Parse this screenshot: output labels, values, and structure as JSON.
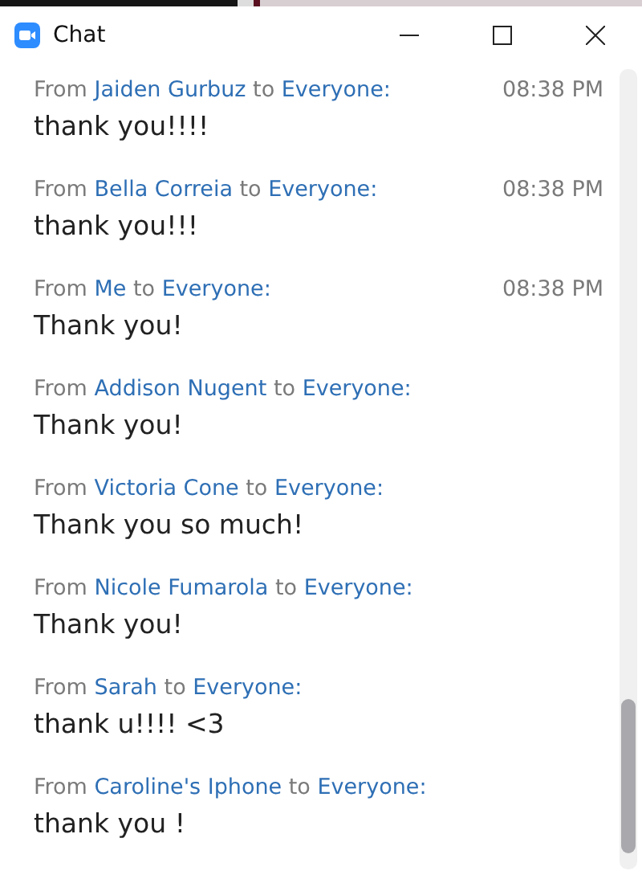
{
  "window": {
    "title": "Chat"
  },
  "messages": [
    {
      "from_label": "From",
      "sender": "Jaiden Gurbuz",
      "to_label": "to",
      "recipient": "Everyone:",
      "time": "08:38 PM",
      "text": "thank you!!!!"
    },
    {
      "from_label": "From",
      "sender": "Bella Correia",
      "to_label": "to",
      "recipient": "Everyone:",
      "time": "08:38 PM",
      "text": "thank you!!!"
    },
    {
      "from_label": "From",
      "sender": "Me",
      "to_label": "to",
      "recipient": "Everyone:",
      "time": "08:38 PM",
      "text": "Thank you!"
    },
    {
      "from_label": "From",
      "sender": "Addison Nugent",
      "to_label": "to",
      "recipient": "Everyone:",
      "text": "Thank you!"
    },
    {
      "from_label": "From",
      "sender": "Victoria Cone",
      "to_label": "to",
      "recipient": "Everyone:",
      "text": "Thank you so much!"
    },
    {
      "from_label": "From",
      "sender": "Nicole Fumarola",
      "to_label": "to",
      "recipient": "Everyone:",
      "text": "Thank you!"
    },
    {
      "from_label": "From",
      "sender": "Sarah",
      "to_label": "to",
      "recipient": "Everyone:",
      "text": "thank u!!!! <3"
    },
    {
      "from_label": "From",
      "sender": "Caroline's Iphone",
      "to_label": "to",
      "recipient": "Everyone:",
      "text": "thank you !"
    }
  ]
}
